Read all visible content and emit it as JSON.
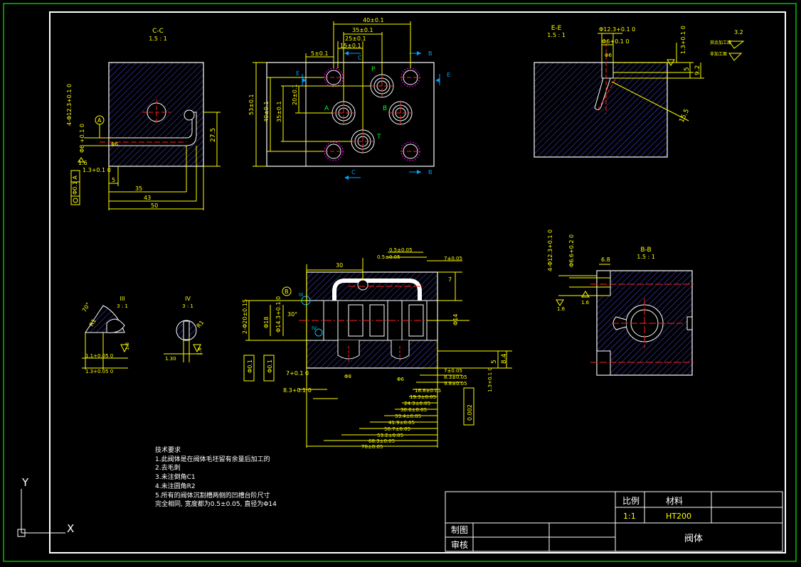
{
  "drawing": {
    "part_name": "阀体",
    "scale_label": "比例",
    "scale_value": "1:1",
    "material_label": "材料",
    "material_value": "HT200",
    "drawn_label": "制图",
    "checked_label": "审核"
  },
  "views": {
    "cc_left": {
      "title": "C-C",
      "scale": "1.5 : 1"
    },
    "ee": {
      "title": "E-E",
      "scale": "1.5 : 1"
    },
    "bb": {
      "title": "B-B",
      "scale": "1.5 : 1"
    },
    "detail_iii": {
      "title": "III",
      "scale": "3 : 1"
    },
    "detail_iv": {
      "title": "IV",
      "scale": "3 : 1"
    }
  },
  "port_labels": [
    "P",
    "A",
    "B",
    "T"
  ],
  "section_markers": [
    "E",
    "E",
    "B",
    "B",
    "C",
    "C"
  ],
  "dimensions": {
    "cc_left": [
      "4-Φ12.3+0.1 0",
      "Φ8 +0.1 0",
      "1.3+0.1 0",
      "Φ0.1 A",
      "1.6",
      "27.5",
      "5",
      "35",
      "43",
      "50",
      "A",
      "Φ6"
    ],
    "top": [
      "40±0.1",
      "35±0.1",
      "25±0.1",
      "15±0.1",
      "5±0.1",
      "53±0.1",
      "40±0.1",
      "35±0.1",
      "20±0.1"
    ],
    "ee": [
      "Φ12.3+0.1 0",
      "Φ6+0.1 0",
      "Φ6",
      "1.3+0.1 0",
      "5",
      "9.2",
      "15.5",
      "3.2",
      "其余加工面",
      "非加工面"
    ],
    "front": [
      "0.5±0.05",
      "0.5±0.05",
      "7±0.05",
      "30",
      "7",
      "B",
      "III",
      "IV",
      "2-Φ20±0.15",
      "Φ18",
      "Φ14.3+0.1 0",
      "30°",
      "Φ14",
      "8.4",
      "5",
      "Φ0.1",
      "Φ0.1",
      "7+0.1 0",
      "8.3+0.1 0",
      "Φ8",
      "Φ6",
      "7±0.05",
      "8.3±0.05",
      "9.8±0.05",
      "1.3+0.1 0",
      "0.002",
      "16.8±0.05",
      "19.3±0.05",
      "24.3±0.05",
      "30.6±0.05",
      "33.4±0.05",
      "41.9±0.05",
      "50.7±0.05",
      "53.2±0.05",
      "68.3±0.05",
      "70±0.05"
    ],
    "bb": [
      "4-Φ12.3+0.1 0",
      "Φ6.6+0.2 0",
      "6.8",
      "1.6",
      "1.6"
    ],
    "detail_iii": [
      "70°",
      "R1",
      "1.1+0.05 0",
      "1.3+0.05 0",
      "1.6"
    ],
    "detail_iv": [
      "R1",
      "1.30",
      "1.6"
    ]
  },
  "technical_requirements": {
    "heading": "技术要求",
    "items": [
      "1.此阀体是在阀体毛坯留有余量后加工的",
      "2.去毛刺",
      "3.未注倒角C1",
      "4.未注圆角R2",
      "5.所有的阀体沉割槽两侧的凹槽台阶尺寸",
      "完全相同, 宽度都为0.5±0.05, 直径为Φ14"
    ]
  },
  "ucs": {
    "x_label": "X",
    "y_label": "Y"
  },
  "colors": {
    "background": "#000000",
    "frame": "#ffffff",
    "outer_frame": "#00ff00",
    "dim": "#ffff00",
    "center": "#ff0000",
    "hatch": "#4a4af0",
    "label": "#00ff00",
    "section_arrow": "#00a0ff",
    "magenta": "#ff00ff"
  }
}
